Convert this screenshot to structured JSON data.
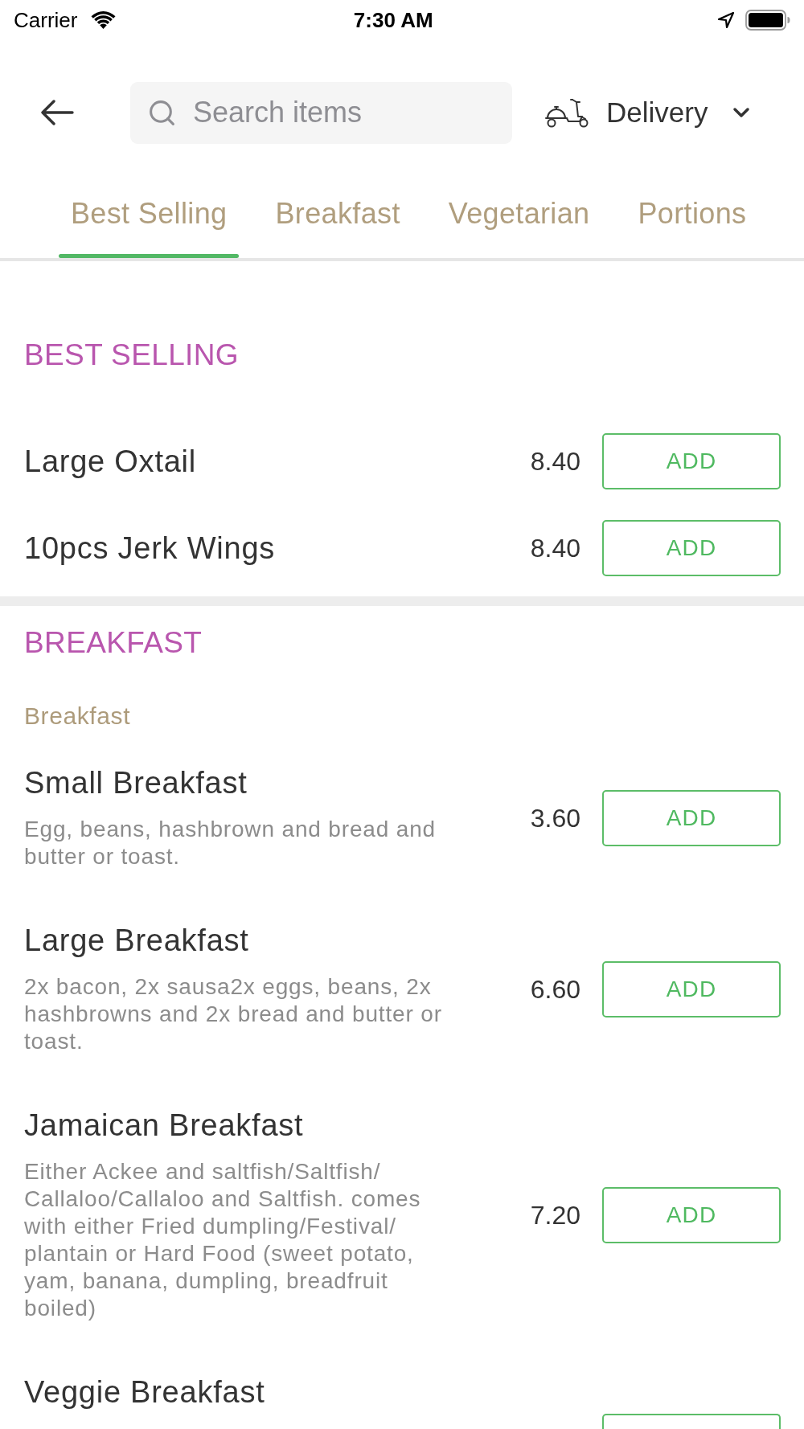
{
  "status_bar": {
    "carrier": "Carrier",
    "time": "7:30 AM"
  },
  "header": {
    "search": {
      "placeholder": "Search items"
    },
    "order_mode": {
      "label": "Delivery"
    }
  },
  "tabs": [
    {
      "label": "Best Selling",
      "selected": true
    },
    {
      "label": "Breakfast",
      "selected": false
    },
    {
      "label": "Vegetarian",
      "selected": false
    },
    {
      "label": "Portions",
      "selected": false
    }
  ],
  "sections": [
    {
      "title": "BEST SELLING",
      "groups": [
        {
          "items": [
            {
              "kind": "priced",
              "name": "Large Oxtail",
              "price": "8.40",
              "button": "ADD"
            },
            {
              "kind": "priced",
              "name": "10pcs Jerk Wings",
              "price": "8.40",
              "button": "ADD"
            }
          ]
        }
      ]
    },
    {
      "title": "BREAKFAST",
      "groups": [
        {
          "title": "Breakfast",
          "items": [
            {
              "kind": "priced",
              "name": "Small Breakfast",
              "description": "Egg, beans, hashbrown and bread and butter or toast.",
              "price": "3.60",
              "button": "ADD"
            },
            {
              "kind": "priced",
              "name": "Large Breakfast",
              "description": "2x bacon, 2x sausa2x eggs, beans, 2x hashbrowns and 2x bread and butter or toast.",
              "price": "6.60",
              "button": "ADD"
            },
            {
              "kind": "priced",
              "name": "Jamaican Breakfast",
              "description": "Either Ackee and saltfish/Saltfish/ Callaloo/Callaloo and Saltfish. comes with either Fried dumpling/Festival/ plantain or Hard Food (sweet potato, yam, banana, dumpling, breadfruit boiled)",
              "price": "7.20",
              "button": "ADD"
            },
            {
              "kind": "partial",
              "name": "Veggie Breakfast"
            }
          ]
        }
      ]
    }
  ]
}
